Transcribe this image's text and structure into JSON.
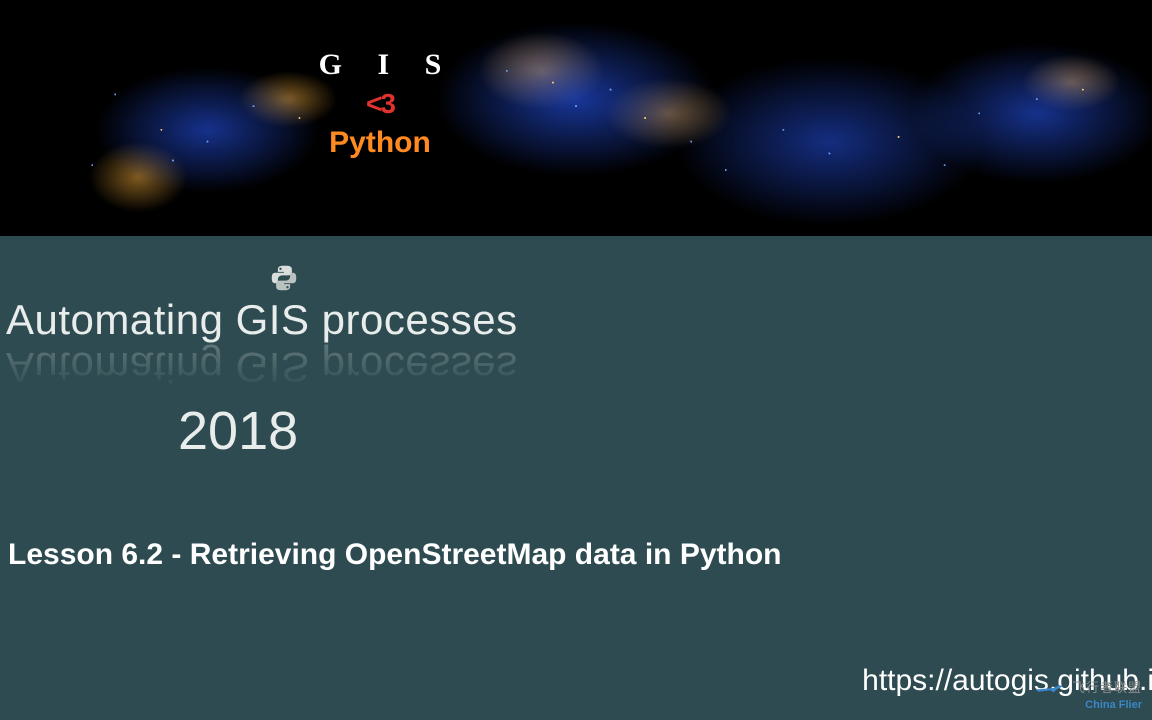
{
  "logo": {
    "line1": "G I S",
    "heart": "<3",
    "line2": "Python"
  },
  "course_title": "Automating GIS processes",
  "year": "2018",
  "lesson_title": "Lesson 6.2 - Retrieving OpenStreetMap data in Python",
  "url": "https://autogis.github.i",
  "watermark": {
    "cn": "飞行者联盟",
    "en": "China Flier"
  },
  "colors": {
    "background": "#2d4b50",
    "accent_orange": "#ff8a1f",
    "heart_red": "#e0322f"
  }
}
